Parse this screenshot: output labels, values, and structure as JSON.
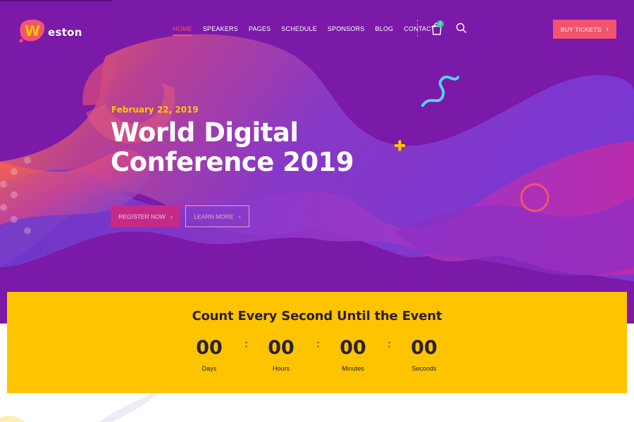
{
  "brand": {
    "name": "eston",
    "logo_letter": "W",
    "accent": "#f3546d",
    "secondary": "#ffc400",
    "hero_bg": "#7b19a8"
  },
  "nav": {
    "items": [
      {
        "label": "HOME"
      },
      {
        "label": "SPEAKERS"
      },
      {
        "label": "PAGES"
      },
      {
        "label": "SCHEDULE"
      },
      {
        "label": "SPONSORS"
      },
      {
        "label": "BLOG"
      },
      {
        "label": "CONTACT"
      }
    ],
    "active_index": 0
  },
  "cart": {
    "count": "2",
    "icon": "shopping-bag-icon"
  },
  "search": {
    "icon": "search-icon"
  },
  "cta": {
    "buy_label": "BUY TICKETS",
    "chevron": "›"
  },
  "hero": {
    "date": "February 22, 2019",
    "title_line1": "World Digital",
    "title_line2": "Conference 2019",
    "register_label": "REGISTER NOW",
    "learn_label": "LEARN MORE",
    "chevron": "›"
  },
  "countdown": {
    "title": "Count Every Second Until the Event",
    "units": [
      {
        "value": "00",
        "label": "Days"
      },
      {
        "value": "00",
        "label": "Hours"
      },
      {
        "value": "00",
        "label": "Minutes"
      },
      {
        "value": "00",
        "label": "Seconds"
      }
    ],
    "separator": ":"
  }
}
